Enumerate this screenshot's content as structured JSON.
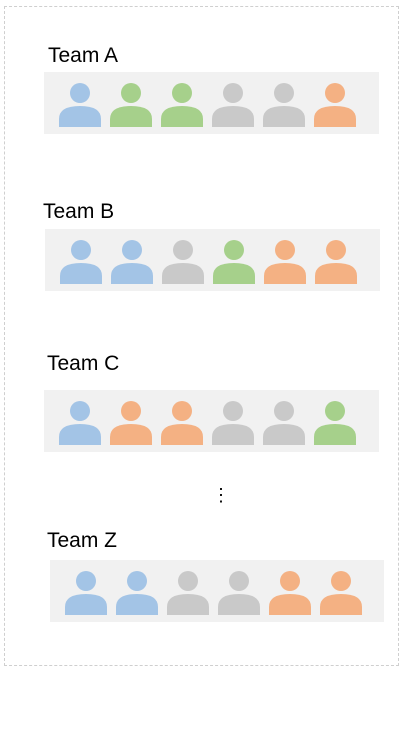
{
  "colors": {
    "blue": "#a3c4e6",
    "green": "#a6d08b",
    "gray": "#c9c9c9",
    "orange": "#f4b183",
    "strip_bg": "#f1f1f1"
  },
  "teams": [
    {
      "label": "Team A",
      "members": [
        "blue",
        "green",
        "green",
        "gray",
        "gray",
        "orange"
      ]
    },
    {
      "label": "Team B",
      "members": [
        "blue",
        "blue",
        "gray",
        "green",
        "orange",
        "orange"
      ]
    },
    {
      "label": "Team C",
      "members": [
        "blue",
        "orange",
        "orange",
        "gray",
        "gray",
        "green"
      ]
    },
    {
      "label": "Team Z",
      "members": [
        "blue",
        "blue",
        "gray",
        "gray",
        "orange",
        "orange"
      ]
    }
  ],
  "ellipsis": "⋮"
}
